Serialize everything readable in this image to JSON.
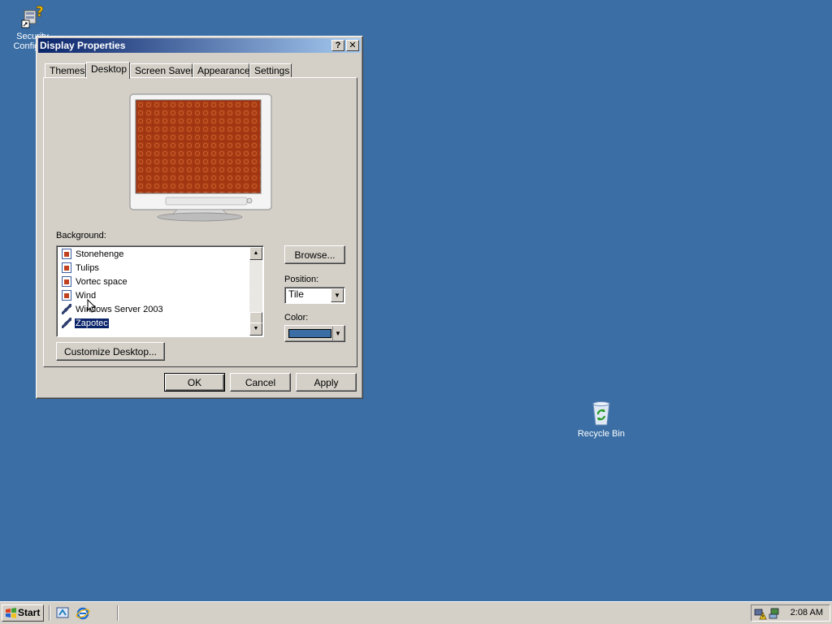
{
  "desktop": {
    "icons": [
      {
        "label": "Security Configu..."
      },
      {
        "label": "Recycle Bin"
      }
    ]
  },
  "dialog": {
    "title": "Display Properties",
    "help_btn": "?",
    "close_btn": "✕",
    "tabs": [
      "Themes",
      "Desktop",
      "Screen Saver",
      "Appearance",
      "Settings"
    ],
    "active_tab": "Desktop",
    "background_label": "Background:",
    "backgrounds": [
      {
        "name": "Stonehenge",
        "icon": "image-icon"
      },
      {
        "name": "Tulips",
        "icon": "image-icon"
      },
      {
        "name": "Vortec space",
        "icon": "image-icon"
      },
      {
        "name": "Wind",
        "icon": "image-icon"
      },
      {
        "name": "Windows Server 2003",
        "icon": "paint-icon"
      },
      {
        "name": "Zapotec",
        "icon": "paint-icon",
        "selected": true
      }
    ],
    "browse_label": "Browse...",
    "position_label": "Position:",
    "position_value": "Tile",
    "color_label": "Color:",
    "color_value": "#3a6ea5",
    "customize_label": "Customize Desktop...",
    "ok_label": "OK",
    "cancel_label": "Cancel",
    "apply_label": "Apply",
    "preview_color": "#a83a14"
  },
  "taskbar": {
    "start_label": "Start",
    "clock": "2:08 AM"
  },
  "colors": {
    "desktop_bg": "#3a6ea5",
    "titlebar": "#0a246a",
    "face": "#d4d0c8"
  }
}
